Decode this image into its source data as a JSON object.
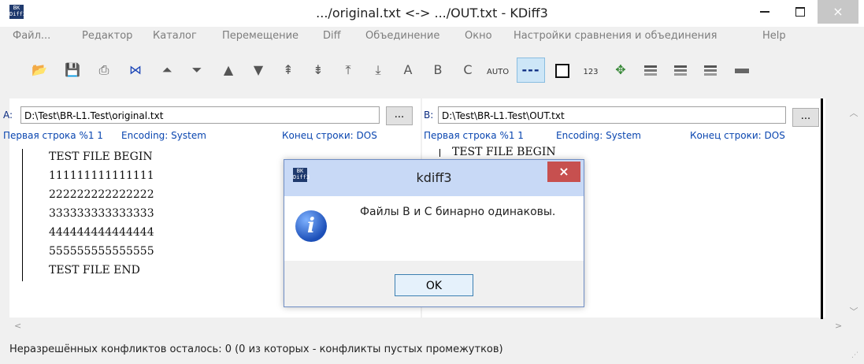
{
  "window": {
    "title": ".../original.txt <-> .../OUT.txt - KDiff3",
    "app_icon_text": [
      "BK",
      "Diff3"
    ],
    "close_glyph": "×"
  },
  "menu": [
    "Файл...",
    "Редактор",
    "Каталог",
    "Перемещение",
    "Diff",
    "Объединение",
    "Окно",
    "Настройки сравнения и объединения",
    "Help"
  ],
  "toolbar": {
    "icons": [
      "open-icon",
      "save-icon",
      "print-icon",
      "bowtie-icon",
      "first-delta-icon",
      "last-delta-icon",
      "prev-delta-icon",
      "next-delta-icon",
      "prev-conflict-icon",
      "next-conflict-icon",
      "prev-unsolved-icon",
      "next-unsolved-icon",
      "select-a-icon",
      "select-b-icon",
      "select-c-icon",
      "auto-advance-icon",
      "show-whitespace-icon",
      "show-whitespace-chars-icon",
      "line-numbers-icon",
      "diff-overview-icon",
      "window-split-icon",
      "horizontal-split-icon",
      "vertical-split-icon",
      "toggle-bar-icon"
    ],
    "labels": {
      "a": "A",
      "b": "B",
      "c": "C",
      "auto": "AUTO",
      "dots": "---",
      "num": "123"
    }
  },
  "pane_a": {
    "label": "A:",
    "path": "D:\\Test\\BR-L1.Test\\original.txt",
    "browse": "...",
    "first_line": "Первая строка %1 1",
    "encoding": "Encoding: System",
    "eol": "Конец строки: DOS",
    "lines": [
      "TEST FILE BEGIN",
      "111111111111111",
      "222222222222222",
      "333333333333333",
      "444444444444444",
      "555555555555555",
      "TEST FILE END"
    ]
  },
  "pane_b": {
    "label": "B:",
    "path": "D:\\Test\\BR-L1.Test\\OUT.txt",
    "browse": "...",
    "first_line": "Первая строка %1 1",
    "encoding": "Encoding: System",
    "eol": "Конец строки: DOS",
    "lines": [
      "TEST FILE BEGIN"
    ]
  },
  "status": "Неразрешённых конфликтов осталось: 0 (0 из которых - конфликты пустых промежутков)",
  "dialog": {
    "title": "kdiff3",
    "message": "Файлы B и C бинарно одинаковы.",
    "ok": "OK",
    "icon_letter": "i"
  }
}
